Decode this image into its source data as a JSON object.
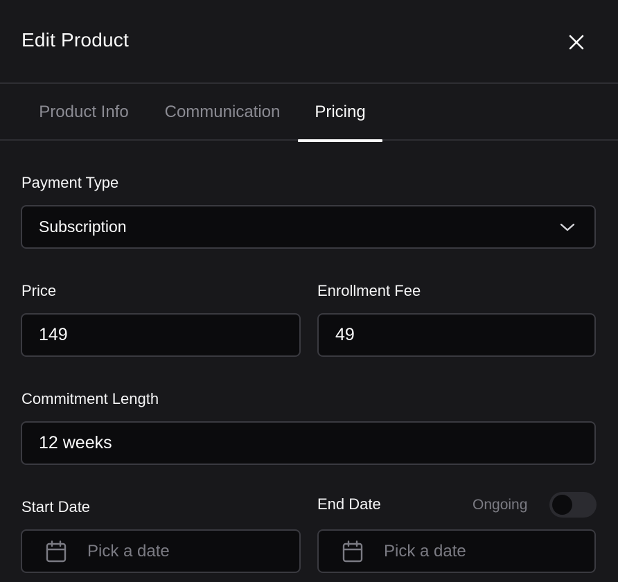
{
  "dialog": {
    "title": "Edit Product",
    "close_icon": "close-icon"
  },
  "tabs": [
    {
      "label": "Product Info",
      "active": false
    },
    {
      "label": "Communication",
      "active": false
    },
    {
      "label": "Pricing",
      "active": true
    }
  ],
  "form": {
    "payment_type": {
      "label": "Payment Type",
      "value": "Subscription",
      "icon": "chevron-down-icon"
    },
    "price": {
      "label": "Price",
      "value": "149"
    },
    "enrollment_fee": {
      "label": "Enrollment Fee",
      "value": "49"
    },
    "commitment_length": {
      "label": "Commitment Length",
      "value": "12 weeks"
    },
    "start_date": {
      "label": "Start Date",
      "placeholder": "Pick a date",
      "icon": "calendar-icon"
    },
    "end_date": {
      "label": "End Date",
      "placeholder": "Pick a date",
      "icon": "calendar-icon"
    },
    "ongoing": {
      "label": "Ongoing",
      "checked": false
    }
  },
  "colors": {
    "background": "#18181b",
    "field_background": "#0b0b0d",
    "border": "#3a3a40",
    "muted_text": "#8b8b93",
    "text": "#fafafa"
  }
}
